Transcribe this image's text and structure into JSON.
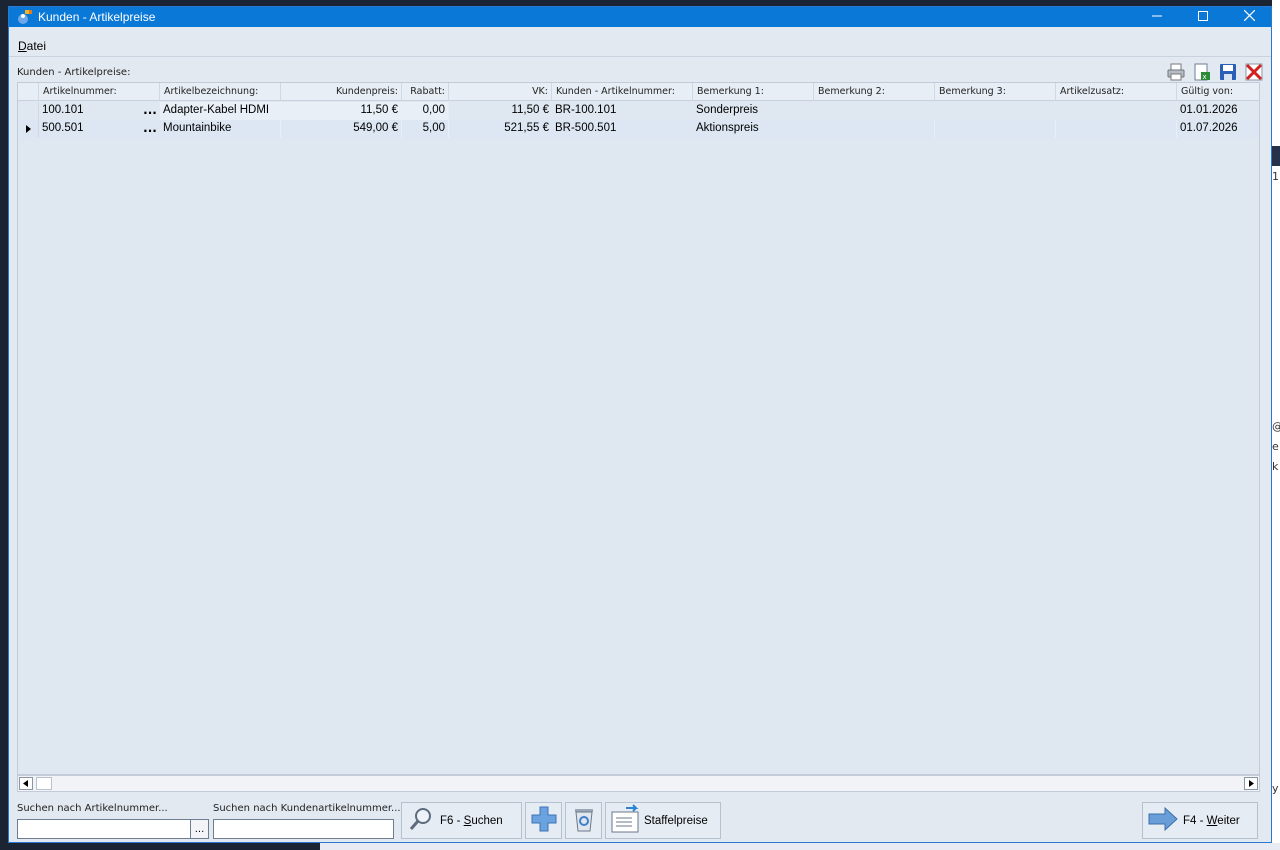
{
  "window": {
    "title": "Kunden - Artikelpreise",
    "menu": {
      "datei_prefix": "D",
      "datei_rest": "atei"
    }
  },
  "grid": {
    "caption": "Kunden - Artikelpreise:",
    "columns": [
      "Artikelnummer:",
      "Artikelbezeichnung:",
      "Kundenpreis:",
      "Rabatt:",
      "VK:",
      "Kunden - Artikelnummer:",
      "Bemerkung 1:",
      "Bemerkung 2:",
      "Bemerkung 3:",
      "Artikelzusatz:",
      "Gültig von:"
    ],
    "rows": [
      {
        "artikelnummer": "100.101",
        "bezeichnung": "Adapter-Kabel HDMI",
        "kundenpreis": "11,50 €",
        "rabatt": "0,00",
        "vk": "11,50 €",
        "kundenartikelnummer": "BR-100.101",
        "bemerkung1": "Sonderpreis",
        "bemerkung2": "",
        "bemerkung3": "",
        "artikelzusatz": "",
        "gueltig_von": "01.01.2026"
      },
      {
        "artikelnummer": "500.501",
        "bezeichnung": "Mountainbike",
        "kundenpreis": "549,00 €",
        "rabatt": "5,00",
        "vk": "521,55 €",
        "kundenartikelnummer": "BR-500.501",
        "bemerkung1": "Aktionspreis",
        "bemerkung2": "",
        "bemerkung3": "",
        "artikelzusatz": "",
        "gueltig_von": "01.07.2026"
      }
    ],
    "ellipsis": "..."
  },
  "search": {
    "artikelnummer_label": "Suchen nach Artikelnummer...",
    "artikelnummer_value": "",
    "kundenartikelnummer_label": "Suchen nach Kundenartikelnummer...",
    "kundenartikelnummer_value": "",
    "ellipsis": "..."
  },
  "buttons": {
    "suchen_prefix": "F6 - ",
    "suchen_key": "S",
    "suchen_rest": "uchen",
    "staffelpreise": "Staffelpreise",
    "weiter_prefix": "F4 - ",
    "weiter_key": "W",
    "weiter_rest": "eiter"
  },
  "background": {
    "right_chars": [
      "1",
      "@",
      "e",
      "k",
      "y"
    ]
  },
  "colors": {
    "titlebar": "#0a78d7",
    "window_bg": "#e3e9f1",
    "grid_bg": "#dfe7f0"
  }
}
